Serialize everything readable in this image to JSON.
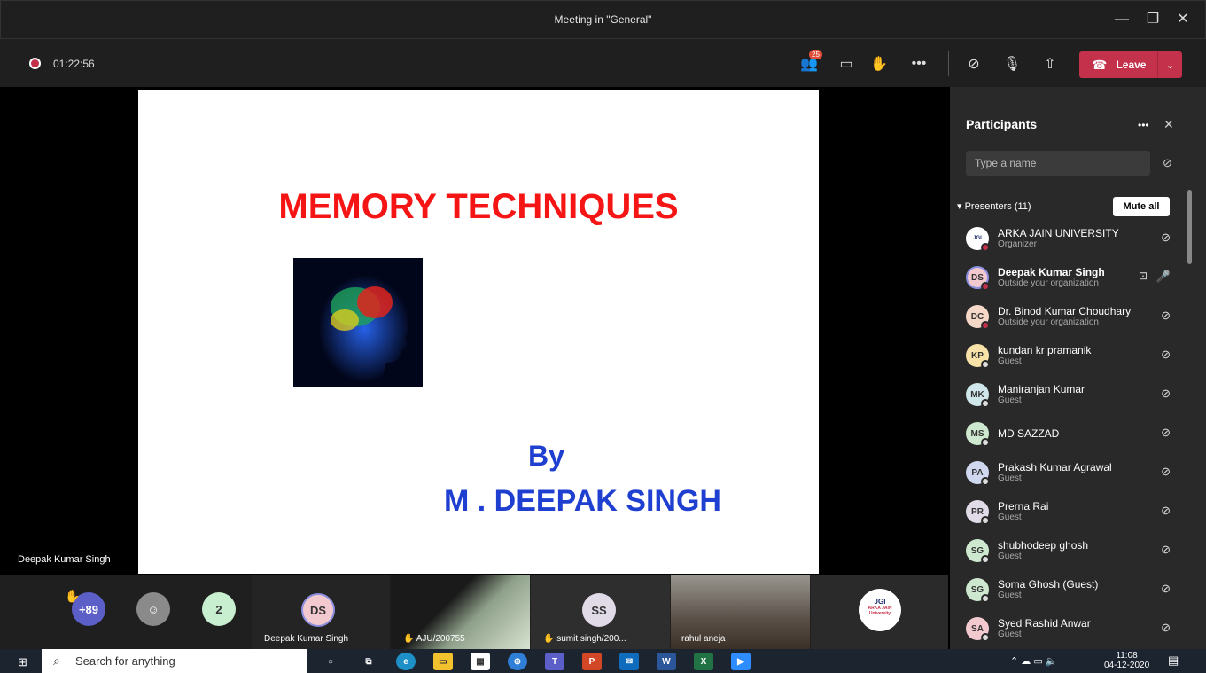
{
  "window": {
    "title": "Meeting in \"General\""
  },
  "meeting": {
    "timer": "01:22:56",
    "participants_badge": "25",
    "leave_label": "Leave"
  },
  "slide": {
    "title": "MEMORY TECHNIQUES",
    "by": "By",
    "author": "M . DEEPAK SINGH"
  },
  "stage": {
    "presenter_label": "Deepak Kumar Singh"
  },
  "strip": {
    "overflow_count": "+89",
    "count_two": "2",
    "tiles": [
      {
        "initials": "DS",
        "label": "Deepak Kumar Singh"
      },
      {
        "label": "AJU/200755"
      },
      {
        "initials": "SS",
        "label": "sumit singh/200..."
      },
      {
        "label": "rahul aneja"
      },
      {
        "logo": "JGI",
        "logo_text": "ARKA JAIN University"
      }
    ]
  },
  "panel": {
    "title": "Participants",
    "search_placeholder": "Type a name",
    "presenters_label": "Presenters (11)",
    "mute_all": "Mute all",
    "participants": [
      {
        "initials": "JGI",
        "name": "ARKA JAIN UNIVERSITY",
        "sub": "Organizer",
        "color": "#ffffff",
        "dot": "#c4314b"
      },
      {
        "initials": "DS",
        "name": "Deepak Kumar Singh",
        "sub": "Outside your organization",
        "color": "#f3c9d0",
        "dot": "#c4314b"
      },
      {
        "initials": "DC",
        "name": "Dr. Binod Kumar Choudhary",
        "sub": "Outside your organization",
        "color": "#f6d8c8",
        "dot": "#c4314b"
      },
      {
        "initials": "KP",
        "name": "kundan kr pramanik",
        "sub": "Guest",
        "color": "#f8e2a8",
        "dot": "#dddddd"
      },
      {
        "initials": "MK",
        "name": "Maniranjan Kumar",
        "sub": "Guest",
        "color": "#cfe6ea",
        "dot": "#dddddd"
      },
      {
        "initials": "MS",
        "name": "MD SAZZAD",
        "sub": "",
        "color": "#cde8cf",
        "dot": "#dddddd"
      },
      {
        "initials": "PA",
        "name": "Prakash Kumar Agrawal",
        "sub": "Guest",
        "color": "#cfd8ef",
        "dot": "#dddddd"
      },
      {
        "initials": "PR",
        "name": "Prerna Rai",
        "sub": "Guest",
        "color": "#e1dbe8",
        "dot": "#dddddd"
      },
      {
        "initials": "SG",
        "name": "shubhodeep ghosh",
        "sub": "Guest",
        "color": "#cde8cf",
        "dot": "#dddddd"
      },
      {
        "initials": "SG",
        "name": "Soma Ghosh (Guest)",
        "sub": "Guest",
        "color": "#cde8cf",
        "dot": "#dddddd"
      },
      {
        "initials": "SA",
        "name": "Syed Rashid Anwar",
        "sub": "Guest",
        "color": "#f3c9d0",
        "dot": "#dddddd"
      }
    ]
  },
  "taskbar": {
    "search_placeholder": "Search for anything",
    "time": "11:08",
    "date": "04-12-2020"
  }
}
